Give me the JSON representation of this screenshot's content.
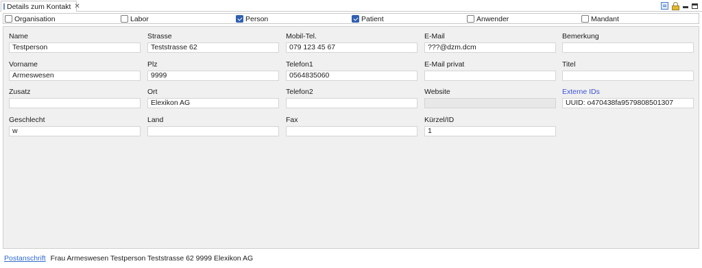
{
  "tab": {
    "title": "Details zum Kontakt",
    "close": "✕"
  },
  "filters": [
    {
      "label": "Organisation",
      "checked": false
    },
    {
      "label": "Labor",
      "checked": false
    },
    {
      "label": "Person",
      "checked": true
    },
    {
      "label": "Patient",
      "checked": true
    },
    {
      "label": "Anwender",
      "checked": false
    },
    {
      "label": "Mandant",
      "checked": false
    }
  ],
  "fields": {
    "name": {
      "label": "Name",
      "value": "Testperson"
    },
    "vorname": {
      "label": "Vorname",
      "value": "Armeswesen"
    },
    "zusatz": {
      "label": "Zusatz",
      "value": ""
    },
    "geschlecht": {
      "label": "Geschlecht",
      "value": "w"
    },
    "strasse": {
      "label": "Strasse",
      "value": "Teststrasse 62"
    },
    "plz": {
      "label": "Plz",
      "value": "9999"
    },
    "ort": {
      "label": "Ort",
      "value": "Elexikon AG"
    },
    "land": {
      "label": "Land",
      "value": ""
    },
    "mobil": {
      "label": "Mobil-Tel.",
      "value": "079 123 45 67"
    },
    "telefon1": {
      "label": "Telefon1",
      "value": "0564835060"
    },
    "telefon2": {
      "label": "Telefon2",
      "value": ""
    },
    "fax": {
      "label": "Fax",
      "value": ""
    },
    "email": {
      "label": "E-Mail",
      "value": "???@dzm.dcm"
    },
    "email_privat": {
      "label": "E-Mail privat",
      "value": ""
    },
    "website": {
      "label": "Website",
      "value": ""
    },
    "kuerzel": {
      "label": "Kürzel/ID",
      "value": "1"
    },
    "bemerkung": {
      "label": "Bemerkung",
      "value": ""
    },
    "titel": {
      "label": "Titel",
      "value": ""
    },
    "externe_ids": {
      "label": "Externe IDs",
      "value": "UUID: o470438fa9579808501307"
    }
  },
  "postanschrift": {
    "link": "Postanschrift",
    "text": "Frau Armeswesen Testperson Teststrasse 62 9999 Elexikon AG"
  }
}
